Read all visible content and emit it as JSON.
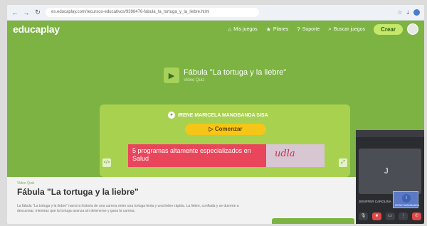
{
  "browser": {
    "url": "es.educaplay.com/recursos-educativos/9398476-fabula_la_tortuga_y_la_liebre.html",
    "back_icon": "arrow-left-icon",
    "forward_icon": "arrow-right-icon",
    "reload_icon": "reload-icon"
  },
  "appbar": {
    "logo": "educaplay",
    "nav": [
      {
        "icon": "⌂",
        "label": "Mis juegos"
      },
      {
        "icon": "★",
        "label": "Planes"
      },
      {
        "icon": "?",
        "label": "Soporte"
      },
      {
        "icon": "⌕",
        "label": "Buscar juegos"
      }
    ],
    "create_label": "Crear",
    "colors": {
      "green": "#7cb342",
      "accent": "#f5c518"
    }
  },
  "hero": {
    "title": "Fábula \"La tortuga y la liebre\"",
    "subtitle": "Video Quiz",
    "author": "IRENE MARICELA MANOBANDA SISA",
    "start_label": "▷ Comenzar"
  },
  "ad": {
    "headline": "5 programas altamente especializados en Salud",
    "brand": "udla"
  },
  "info": {
    "type": "Video Quiz",
    "title": "Fábula \"La tortuga y la liebre\"",
    "description": "La fábula \"La tortuga y la liebre\" narra la historia de una carrera entre una tortuga lenta y una liebre rápida. La liebre, confiada y se duerme a descansar, mientras que la tortuga avanza sin detenerse y gana la carrera."
  },
  "meet": {
    "participant_letter": "J",
    "participant_name": "JENIFFER CAROLINA",
    "self_label": "IRENE MANOBANDA"
  }
}
